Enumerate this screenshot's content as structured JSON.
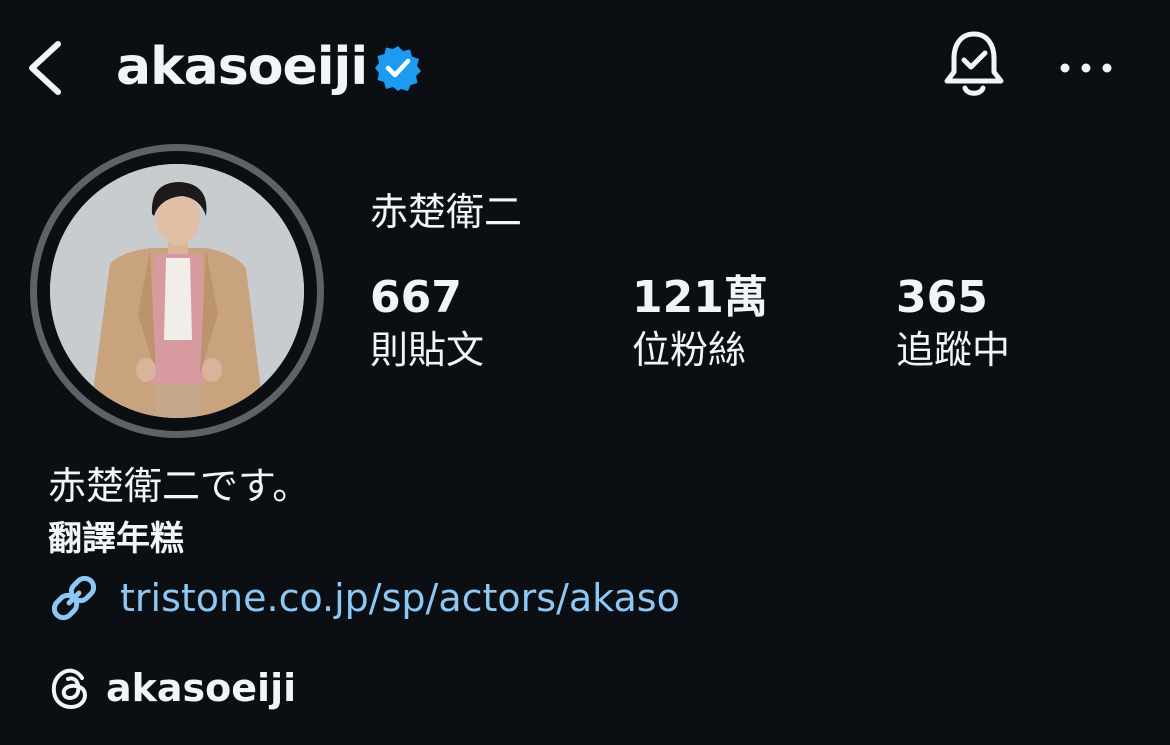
{
  "header": {
    "username": "akasoeiji",
    "icons": {
      "back": "chevron-left-icon",
      "verified": "verified-badge-icon",
      "notifications": "bell-check-icon",
      "more": "more-horizontal-icon"
    }
  },
  "profile": {
    "display_name": "赤楚衛二",
    "avatar": "profile-photo"
  },
  "stats": {
    "posts": {
      "count": "667",
      "label": "則貼文"
    },
    "followers": {
      "count": "121萬",
      "label": "位粉絲"
    },
    "following": {
      "count": "365",
      "label": "追蹤中"
    }
  },
  "bio": {
    "text": "赤楚衛二です。",
    "translate_label": "翻譯年糕",
    "link": "tristone.co.jp/sp/actors/akaso",
    "link_icon": "link-icon",
    "threads_handle": "akasoeiji",
    "threads_icon": "threads-icon"
  },
  "colors": {
    "background": "#0b0f14",
    "text": "#f2f4f6",
    "link": "#8dc7f3",
    "verified": "#1d9bf0",
    "avatar_ring": "#5e6167"
  }
}
